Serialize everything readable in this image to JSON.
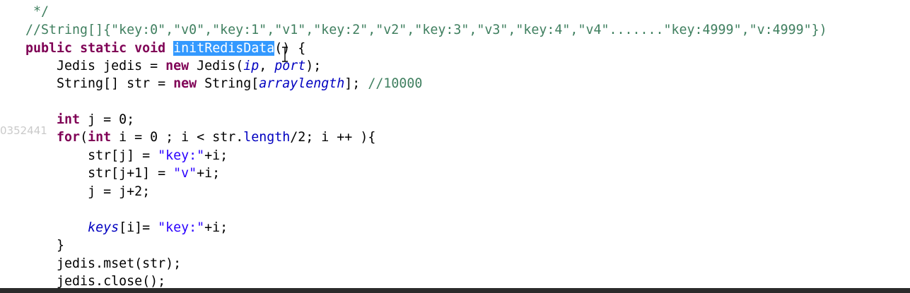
{
  "editor": {
    "lines": [
      {
        "id": "comment-end",
        "indent": "  ",
        "tokens": [
          {
            "t": "*/",
            "c": "comment"
          }
        ]
      },
      {
        "id": "comment-example",
        "indent": "  ",
        "tokens": [
          {
            "t": "//String[]{\"key:0\",\"v0\",\"key:1\",\"v1\",\"key:2\",\"v2\",\"key:3\",\"v3\",\"key:4\",\"v4\".......\"key:4999\",\"v:4999\"})",
            "c": "comment"
          }
        ]
      },
      {
        "id": "method-signature",
        "indent": "  ",
        "tokens": [
          {
            "t": "public",
            "c": "key"
          },
          {
            "t": " ",
            "c": "plain"
          },
          {
            "t": "static",
            "c": "key"
          },
          {
            "t": " ",
            "c": "plain"
          },
          {
            "t": "void",
            "c": "key"
          },
          {
            "t": " ",
            "c": "plain"
          },
          {
            "t": "initRedisData",
            "c": "sel"
          },
          {
            "t": "() {",
            "c": "plain"
          }
        ]
      },
      {
        "id": "jedis-init",
        "indent": "      ",
        "tokens": [
          {
            "t": "Jedis jedis = ",
            "c": "plain"
          },
          {
            "t": "new",
            "c": "key"
          },
          {
            "t": " Jedis(",
            "c": "plain"
          },
          {
            "t": "ip",
            "c": "field"
          },
          {
            "t": ", ",
            "c": "plain"
          },
          {
            "t": "port",
            "c": "field"
          },
          {
            "t": ");",
            "c": "plain"
          }
        ]
      },
      {
        "id": "str-array",
        "indent": "      ",
        "tokens": [
          {
            "t": "String[] str = ",
            "c": "plain"
          },
          {
            "t": "new",
            "c": "key"
          },
          {
            "t": " String[",
            "c": "plain"
          },
          {
            "t": "arraylength",
            "c": "field"
          },
          {
            "t": "]; ",
            "c": "plain"
          },
          {
            "t": "//10000",
            "c": "comment"
          }
        ]
      },
      {
        "id": "blank-1",
        "indent": "",
        "tokens": []
      },
      {
        "id": "int-j",
        "indent": "      ",
        "tokens": [
          {
            "t": "int",
            "c": "key"
          },
          {
            "t": " j = 0;",
            "c": "plain"
          }
        ]
      },
      {
        "id": "for-loop",
        "indent": "      ",
        "tokens": [
          {
            "t": "for",
            "c": "key"
          },
          {
            "t": "(",
            "c": "plain"
          },
          {
            "t": "int",
            "c": "key"
          },
          {
            "t": " i = 0 ; i < str.",
            "c": "plain"
          },
          {
            "t": "length",
            "c": "field-plain"
          },
          {
            "t": "/2; i ++ ){",
            "c": "plain"
          }
        ]
      },
      {
        "id": "assign-key",
        "indent": "          ",
        "tokens": [
          {
            "t": "str[j] = ",
            "c": "plain"
          },
          {
            "t": "\"key:\"",
            "c": "str"
          },
          {
            "t": "+i;",
            "c": "plain"
          }
        ]
      },
      {
        "id": "assign-value",
        "indent": "          ",
        "tokens": [
          {
            "t": "str[j+1] = ",
            "c": "plain"
          },
          {
            "t": "\"v\"",
            "c": "str"
          },
          {
            "t": "+i;",
            "c": "plain"
          }
        ]
      },
      {
        "id": "increment-j",
        "indent": "          ",
        "tokens": [
          {
            "t": "j = j+2;",
            "c": "plain"
          }
        ]
      },
      {
        "id": "blank-2",
        "indent": "",
        "tokens": []
      },
      {
        "id": "assign-keys",
        "indent": "          ",
        "tokens": [
          {
            "t": "keys",
            "c": "field"
          },
          {
            "t": "[i]= ",
            "c": "plain"
          },
          {
            "t": "\"key:\"",
            "c": "str"
          },
          {
            "t": "+i;",
            "c": "plain"
          }
        ]
      },
      {
        "id": "close-for",
        "indent": "      ",
        "tokens": [
          {
            "t": "}",
            "c": "plain"
          }
        ]
      },
      {
        "id": "mset-call",
        "indent": "      ",
        "tokens": [
          {
            "t": "jedis.mset(str);",
            "c": "plain"
          }
        ]
      },
      {
        "id": "close-call",
        "indent": "      ",
        "tokens": [
          {
            "t": "jedis.close();",
            "c": "plain"
          }
        ]
      }
    ]
  },
  "overlay": {
    "watermark_text": "0352441",
    "cursor_icon": "text-ibeam-cursor"
  },
  "colors": {
    "comment": "#3f7f5f",
    "keyword": "#7f0055",
    "string": "#2a00ff",
    "field": "#0000c0",
    "selection": "#3399ff"
  }
}
